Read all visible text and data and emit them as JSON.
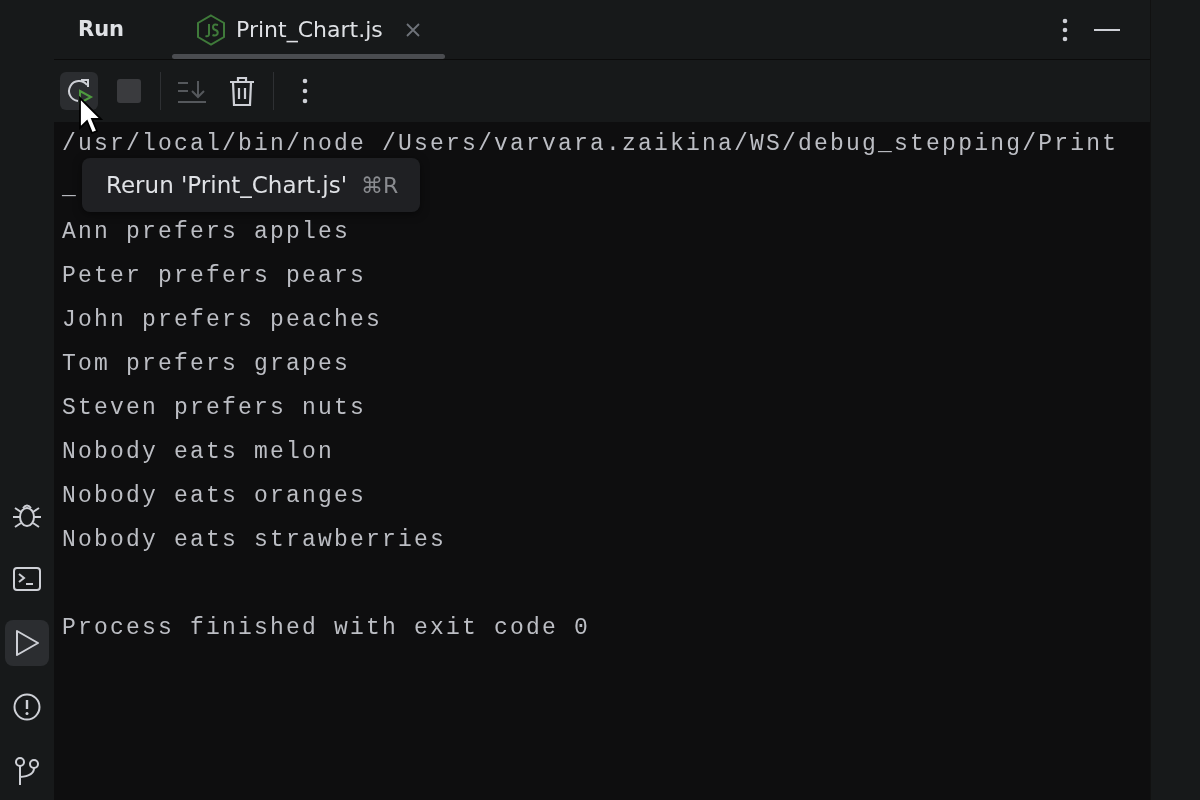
{
  "panel": {
    "title": "Run",
    "tabs": [
      {
        "label": "Print_Chart.js",
        "selected": true
      }
    ]
  },
  "toolbar": [
    {
      "kind": "rerun",
      "hovered": true,
      "disabled": false
    },
    {
      "kind": "stop",
      "hovered": false,
      "disabled": true
    },
    {
      "kind": "separator"
    },
    {
      "kind": "scroll-end",
      "hovered": false,
      "disabled": true
    },
    {
      "kind": "trash",
      "hovered": false,
      "disabled": false
    },
    {
      "kind": "separator"
    },
    {
      "kind": "more",
      "hovered": false,
      "disabled": false
    }
  ],
  "tooltip": {
    "text": "Rerun 'Print_Chart.js'",
    "shortcut": "⌘R"
  },
  "console": [
    "/usr/local/bin/node /Users/varvara.zaikina/WS/debug_stepping/Print",
    "_",
    "Ann prefers apples",
    "Peter prefers pears",
    "John prefers peaches",
    "Tom prefers grapes",
    "Steven prefers nuts",
    "Nobody eats melon",
    "Nobody eats oranges",
    "Nobody eats strawberries"
  ],
  "exit_message": "Process finished with exit code 0",
  "sidebar": [
    {
      "kind": "debug",
      "selected": false
    },
    {
      "kind": "terminal",
      "selected": false
    },
    {
      "kind": "run",
      "selected": true
    },
    {
      "kind": "problems",
      "selected": false
    },
    {
      "kind": "git",
      "selected": false
    }
  ]
}
